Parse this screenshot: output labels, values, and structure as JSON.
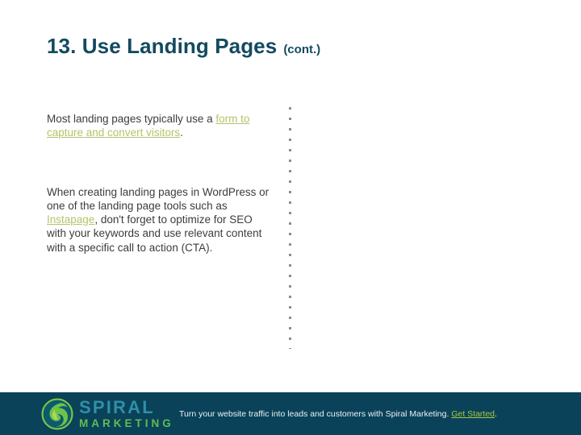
{
  "slide": {
    "background_color": "#ffffff",
    "title": {
      "main": "13. Use Landing Pages",
      "suffix": "(cont.)",
      "color": "#134a60"
    },
    "body": {
      "text_color": "#3c3c3c",
      "link_color": "#b3c46b",
      "paragraph_1": {
        "before_link": "Most landing pages typically use a ",
        "link": "form to capture and convert visitors",
        "after_link": "."
      },
      "paragraph_2": {
        "before_link": "When creating landing pages in WordPress or one of the landing page tools such as ",
        "link": "Instapage",
        "after_link": ", don't forget to optimize for SEO with your keywords and use relevant content with a specific call to action (CTA)."
      }
    },
    "divider": {
      "style": "dotted-vertical",
      "color": "#8c8c8c"
    }
  },
  "footer": {
    "background_color": "#0a4259",
    "logo": {
      "icon_name": "spiral-leaf-circle-icon",
      "word_primary": "SPIRAL",
      "word_secondary": "MARKETING",
      "primary_color": "#2f8fa8",
      "secondary_color": "#5fbe52"
    },
    "tagline": {
      "text": "Turn your website traffic into leads and customers with Spiral Marketing. ",
      "link": "Get Started",
      "trailing": ".",
      "text_color": "#e9f2f5",
      "link_color": "#a9cb3c"
    }
  }
}
